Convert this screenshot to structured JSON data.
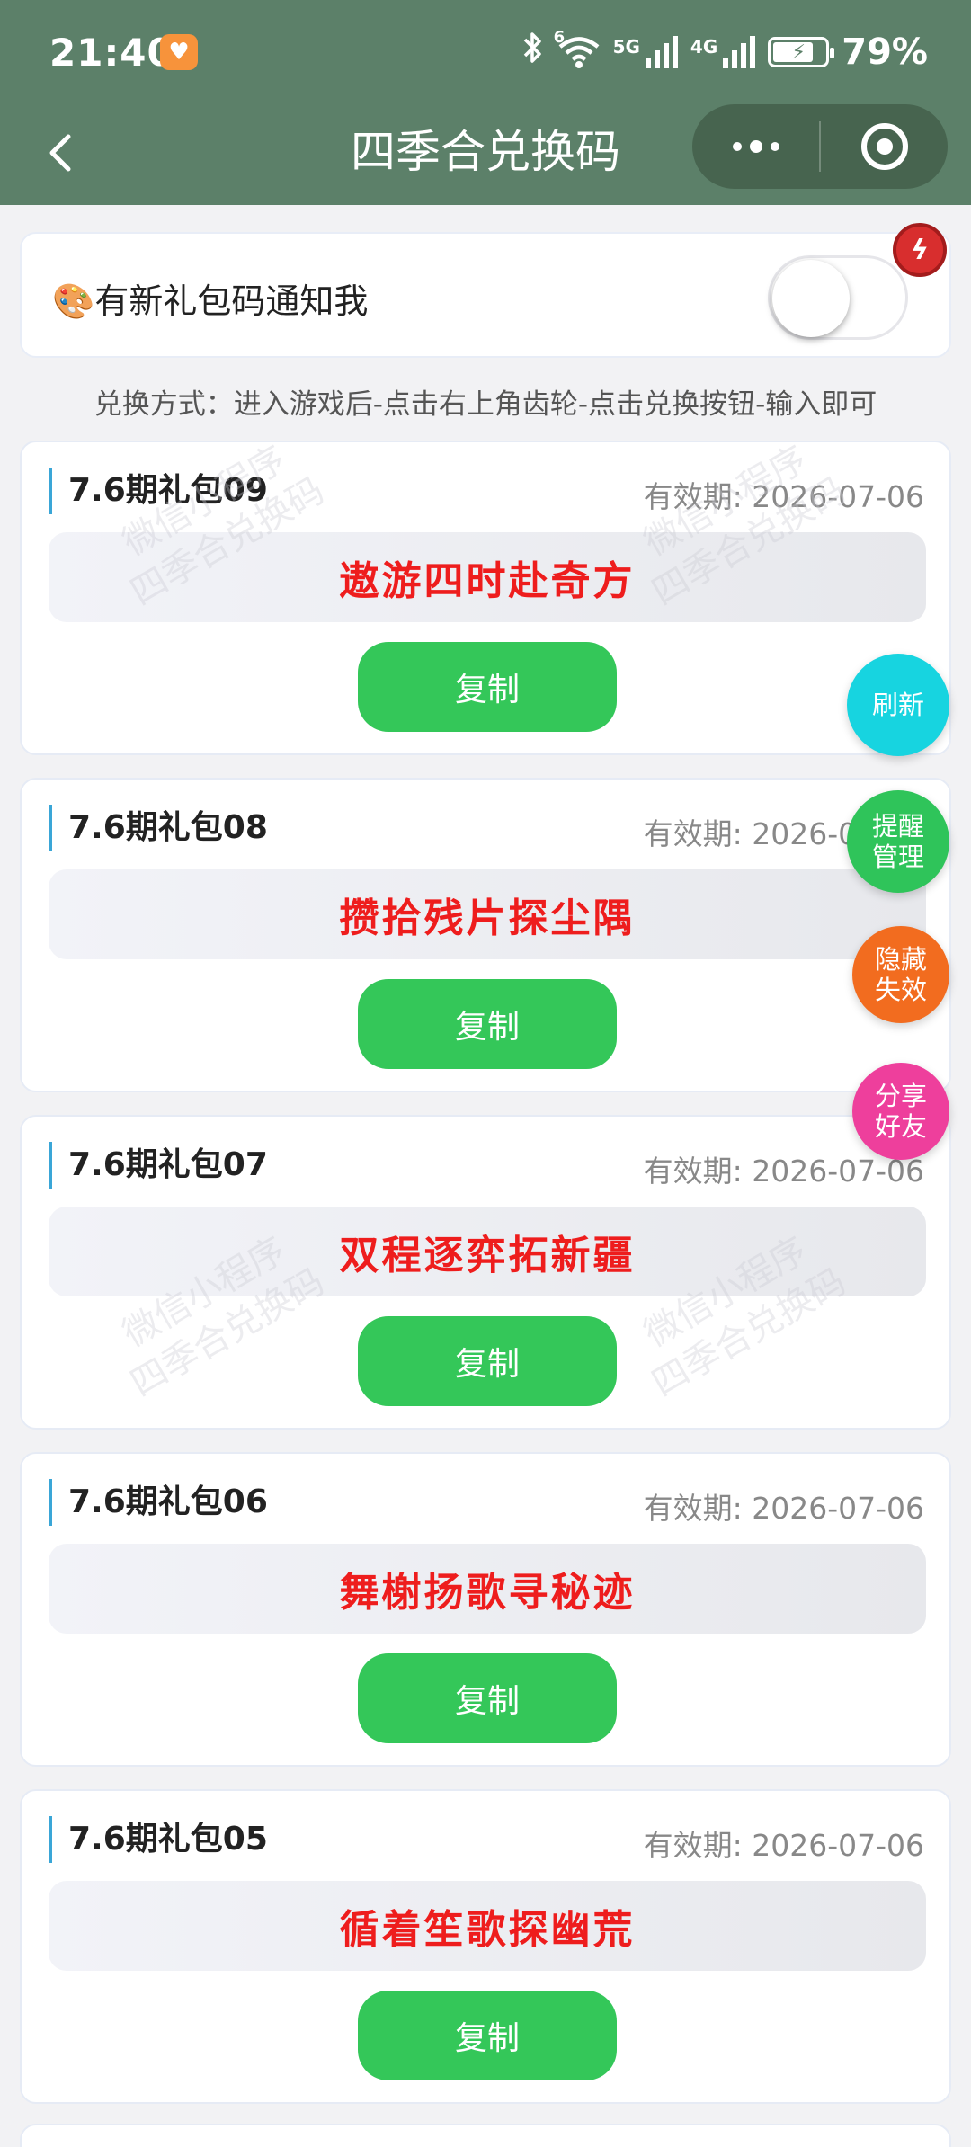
{
  "status_bar": {
    "time": "21:40",
    "wifi_sup": "6",
    "sig1_label": "5G",
    "sig2_label": "4G",
    "battery": "79%"
  },
  "nav": {
    "title": "四季合兑换码"
  },
  "notify": {
    "emoji": "🎨",
    "label": "有新礼包码通知我",
    "toggle_on": false
  },
  "instructions": "兑换方式：进入游戏后-点击右上角齿轮-点击兑换按钮-输入即可",
  "watermark": {
    "line1": "微信小程序",
    "line2": "四季合兑换码"
  },
  "cards": [
    {
      "title": "7.6期礼包09",
      "expiry": "有效期: 2026-07-06",
      "code": "遨游四时赴奇方",
      "copy": "复制"
    },
    {
      "title": "7.6期礼包08",
      "expiry": "有效期: 2026-07-06",
      "code": "攒拾残片探尘隅",
      "copy": "复制"
    },
    {
      "title": "7.6期礼包07",
      "expiry": "有效期: 2026-07-06",
      "code": "双程逐弈拓新疆",
      "copy": "复制"
    },
    {
      "title": "7.6期礼包06",
      "expiry": "有效期: 2026-07-06",
      "code": "舞榭扬歌寻秘迹",
      "copy": "复制"
    },
    {
      "title": "7.6期礼包05",
      "expiry": "有效期: 2026-07-06",
      "code": "循着笙歌探幽荒",
      "copy": "复制"
    }
  ],
  "float_buttons": {
    "refresh": "刷新",
    "reminder": "提醒\n管理",
    "hide_expired": "隐藏\n失效",
    "share": "分享\n好友"
  },
  "colors": {
    "header_bg": "#5c8069",
    "code_text": "#ee1d1d",
    "copy_button": "#34c759",
    "refresh_button": "#17d4e0",
    "reminder_button": "#2fc45a",
    "hide_button": "#f26c1f",
    "share_button": "#ee3f9c"
  },
  "icons": {
    "back": "chevron-left-icon",
    "more": "more-dots-icon",
    "close_capsule": "target-circle-icon",
    "bolt_badge": "lightning-icon",
    "bluetooth": "bluetooth-icon",
    "wifi": "wifi-icon",
    "battery": "battery-charging-icon"
  }
}
